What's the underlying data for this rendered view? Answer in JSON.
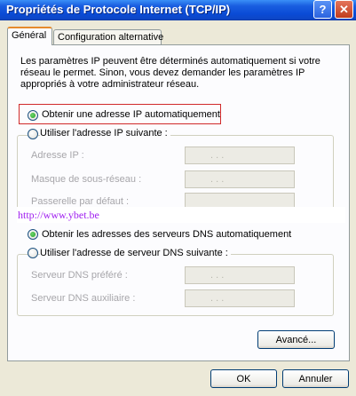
{
  "window": {
    "title": "Propriétés de Protocole Internet (TCP/IP)"
  },
  "titlebar": {
    "help_label": "?",
    "close_label": "✕"
  },
  "tabs": [
    {
      "label": "Général"
    },
    {
      "label": "Configuration alternative"
    }
  ],
  "description": "Les paramètres IP peuvent être déterminés automatiquement si votre réseau le permet. Sinon, vous devez demander les paramètres IP appropriés à votre administrateur réseau.",
  "ip": {
    "auto_label": "Obtenir une adresse IP automatiquement",
    "manual_label": "Utiliser l'adresse IP suivante :",
    "selected": "auto",
    "fields": [
      {
        "label": "Adresse IP :"
      },
      {
        "label": "Masque de sous-réseau :"
      },
      {
        "label": "Passerelle par défaut :"
      }
    ]
  },
  "watermark": "http://www.ybet.be",
  "dns": {
    "auto_label": "Obtenir les adresses des serveurs DNS automatiquement",
    "manual_label": "Utiliser l'adresse de serveur DNS suivante :",
    "selected": "auto",
    "fields": [
      {
        "label": "Serveur DNS préféré :"
      },
      {
        "label": "Serveur DNS auxiliaire :"
      }
    ]
  },
  "field_dots": ".   .   .",
  "buttons": {
    "advanced": "Avancé...",
    "ok": "OK",
    "cancel": "Annuler"
  }
}
